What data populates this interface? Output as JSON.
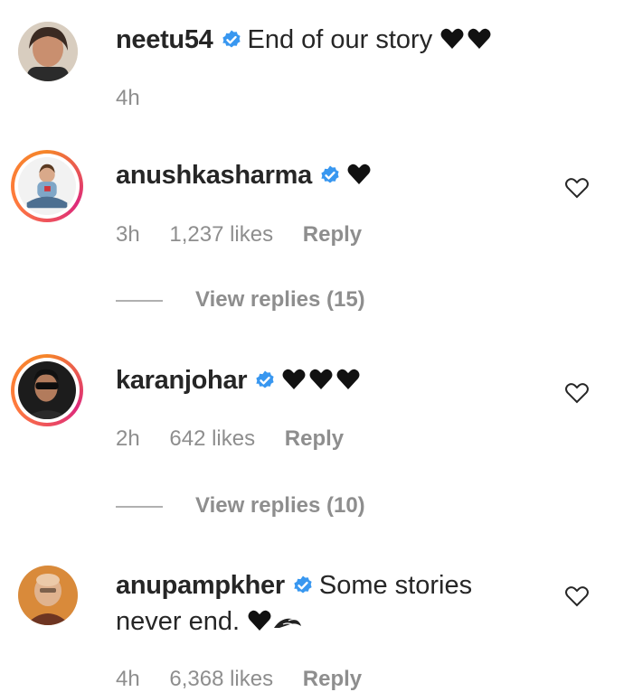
{
  "comments": [
    {
      "username": "neetu54",
      "text": "End of our story",
      "time": "4h",
      "likes": "",
      "reply": ""
    },
    {
      "username": "anushkasharma",
      "text": "",
      "time": "3h",
      "likes": "1,237 likes",
      "reply": "Reply",
      "view_replies": "View replies (15)"
    },
    {
      "username": "karanjohar",
      "text": "",
      "time": "2h",
      "likes": "642 likes",
      "reply": "Reply",
      "view_replies": "View replies (10)"
    },
    {
      "username": "anupampkher",
      "text_line1": "Some stories",
      "text_line2": "never end.",
      "time": "4h",
      "likes": "6,368 likes",
      "reply": "Reply"
    }
  ],
  "colors": {
    "verified": "#3897f0",
    "meta": "#8e8e8e",
    "text": "#262626"
  },
  "icons": [
    "verified-badge-icon",
    "black-heart-icon",
    "like-heart-outline-icon",
    "wind-face-emoji-icon"
  ]
}
